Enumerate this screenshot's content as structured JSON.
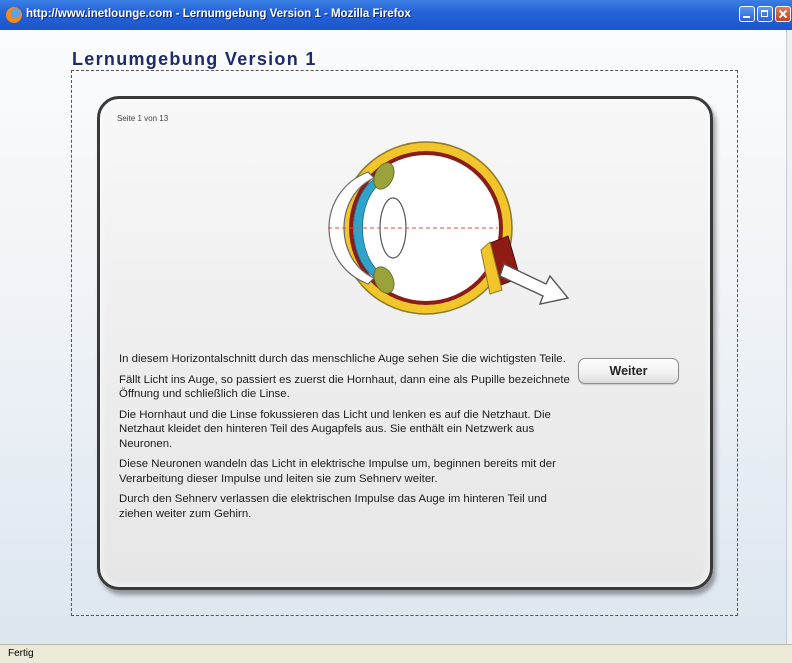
{
  "window": {
    "title": "http://www.inetlounge.com - Lernumgebung Version 1 - Mozilla Firefox"
  },
  "page": {
    "heading": "Lernumgebung Version 1"
  },
  "lesson": {
    "page_counter": "Seite 1 von 13",
    "next_button": "Weiter",
    "paragraphs": [
      "In diesem Horizontalschnitt durch das menschliche Auge sehen Sie die wichtigsten Teile.",
      "Fällt Licht ins Auge, so passiert es zuerst die Hornhaut, dann eine als Pupille bezeichnete Öffnung und schließlich die Linse.",
      "Die Hornhaut und die Linse fokussieren das Licht und lenken es auf die Netzhaut. Die Netzhaut kleidet den hinteren Teil des Augapfels aus. Sie enthält ein Netzwerk aus Neuronen.",
      "Diese Neuronen wandeln das Licht in elektrische Impulse um, beginnen bereits mit der Verarbeitung dieser Impulse und leiten sie zum Sehnerv weiter.",
      "Durch den Sehnerv verlassen die elektrischen Impulse das Auge im hinteren Teil und ziehen weiter zum Gehirn."
    ]
  },
  "status": {
    "text": "Fertig"
  },
  "colors": {
    "titlebar": "#2663d8",
    "heading": "#1e2a6b",
    "sclera": "#f2c62a",
    "choroid": "#8a1d18",
    "cornea": "#2fa3c9",
    "optic_nerve": "#8e1c14"
  }
}
